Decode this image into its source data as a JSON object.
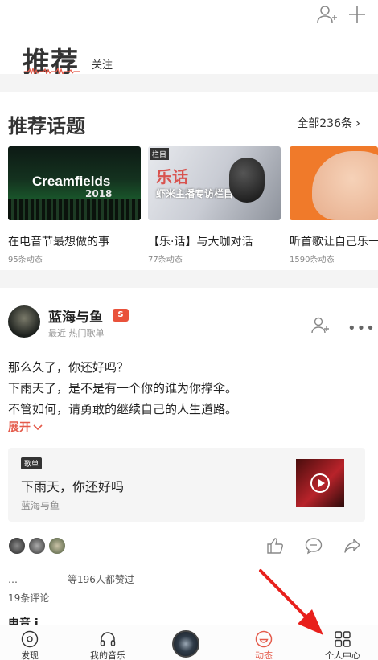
{
  "header": {
    "main_tab": "推荐",
    "sub_tab": "关注"
  },
  "topics": {
    "title": "推荐话题",
    "all_link": "全部236条",
    "items": [
      {
        "title": "在电音节最想做的事",
        "count": "95条动态",
        "thumb_text": "Creamfields",
        "thumb_sub": "2018"
      },
      {
        "title": "【乐·话】与大咖对话",
        "count": "77条动态",
        "thumb_tag": "栏目",
        "thumb_text": "乐话",
        "thumb_sub": "虾米主播专访栏目"
      },
      {
        "title": "听首歌让自己乐一",
        "count": "1590条动态"
      }
    ]
  },
  "post": {
    "username": "蓝海与鱼",
    "badge": "S",
    "subtitle": "最近 热门歌单",
    "lines": [
      "那么久了，你还好吗？",
      "下雨天了，是不是有一个你的谁为你撑伞。",
      "不管如何，请勇敢的继续自己的人生道路。"
    ],
    "expand": "展开",
    "playlist": {
      "tag": "歌单",
      "title": "下雨天，你还好吗",
      "author": "蓝海与鱼"
    },
    "likes_prefix": "…",
    "likes_text": "等196人都赞过",
    "comments": "19条评论",
    "next_preview": "电音 i ."
  },
  "nav": {
    "items": [
      {
        "label": "发现"
      },
      {
        "label": "我的音乐"
      },
      {
        "label": ""
      },
      {
        "label": "动态"
      },
      {
        "label": "个人中心"
      }
    ]
  },
  "colors": {
    "accent": "#e45a4a",
    "annotation_arrow": "#e8201c"
  }
}
